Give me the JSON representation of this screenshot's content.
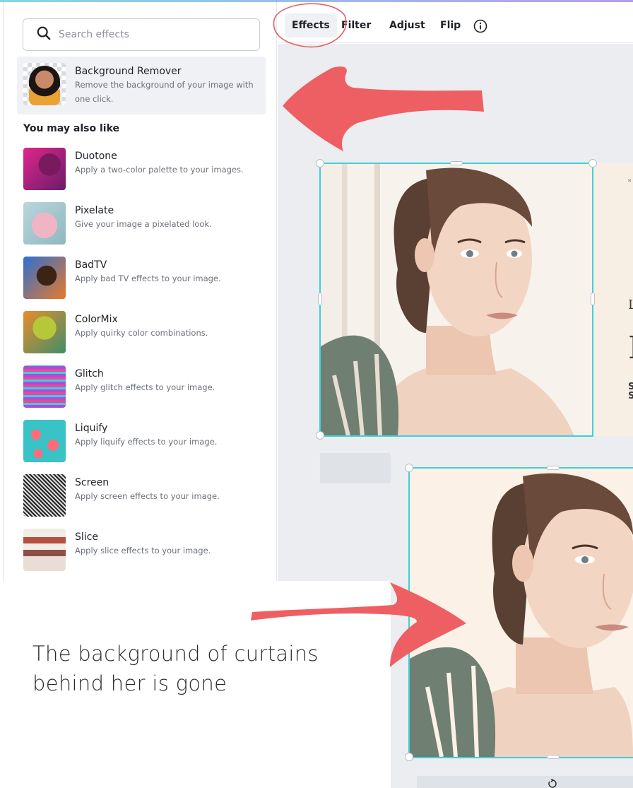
{
  "search": {
    "placeholder": "Search effects"
  },
  "featured": {
    "name": "Background Remover",
    "description": "Remove the background of your image with one click."
  },
  "section_heading": "You may also like",
  "effects": [
    {
      "name": "Duotone",
      "description": "Apply a two-color palette to your images."
    },
    {
      "name": "Pixelate",
      "description": "Give your image a pixelated look."
    },
    {
      "name": "BadTV",
      "description": "Apply bad TV effects to your image."
    },
    {
      "name": "ColorMix",
      "description": "Apply quirky color combinations."
    },
    {
      "name": "Glitch",
      "description": "Apply glitch effects to your image."
    },
    {
      "name": "Liquify",
      "description": "Apply liquify effects to your image."
    },
    {
      "name": "Screen",
      "description": "Apply screen effects to your image."
    },
    {
      "name": "Slice",
      "description": "Apply slice effects to your image."
    }
  ],
  "toolbar": {
    "effects": "Effects",
    "filter": "Filter",
    "adjust": "Adjust",
    "flip": "Flip",
    "info_icon": "info-icon"
  },
  "design_text": {
    "letter_l": "L",
    "letter_i": "I",
    "letter_s1": "S",
    "letter_s2": "S"
  },
  "caption": "The background of curtains behind her is gone",
  "colors": {
    "annotation": "#ee5f63",
    "selection": "#3fd0d8",
    "canvas": "#ebedf0",
    "leaf": "#6f7f71"
  }
}
